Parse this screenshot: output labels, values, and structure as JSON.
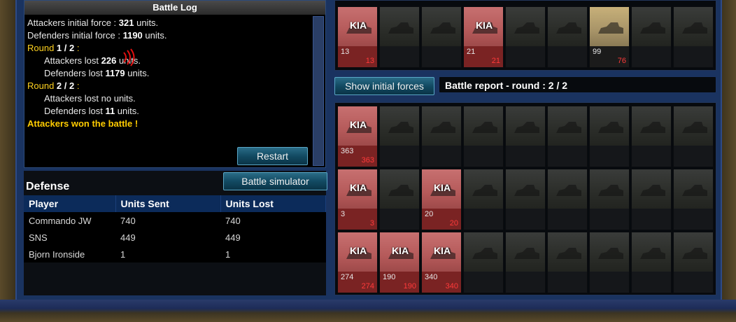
{
  "battle_log": {
    "title": "Battle Log",
    "lines": {
      "l1_pre": "Attackers initial force : ",
      "l1_val": "321",
      "l1_post": " units.",
      "l2_pre": "Defenders initial force : ",
      "l2_val": "1190",
      "l2_post": " units.",
      "r1_pre": "Round ",
      "r1_val": "1 / 2",
      "r1_post": " :",
      "r1a_pre": "Attackers lost ",
      "r1a_val": "226",
      "r1a_post": " units.",
      "r1d_pre": "Defenders lost ",
      "r1d_val": "1179",
      "r1d_post": " units.",
      "r2_pre": "Round ",
      "r2_val": "2 / 2",
      "r2_post": " :",
      "r2a": "Attackers lost no units.",
      "r2d_pre": "Defenders lost ",
      "r2d_val": "11",
      "r2d_post": " units.",
      "result": "Attackers won the battle !"
    },
    "restart_label": "Restart"
  },
  "defense": {
    "title": "Defense",
    "simulator_label": "Battle simulator",
    "columns": [
      "Player",
      "Units Sent",
      "Units Lost"
    ],
    "rows": [
      [
        "Commando JW",
        "740",
        "740"
      ],
      [
        "SNS",
        "449",
        "449"
      ],
      [
        "Bjorn Ironside",
        "1",
        "1"
      ]
    ]
  },
  "report": {
    "show_initial_label": "Show initial forces",
    "title": "Battle report - round : 2 / 2",
    "kia_label": "KIA"
  },
  "top_row": [
    {
      "type": "kia",
      "sent": "13",
      "lost": "13"
    },
    {
      "type": "empty"
    },
    {
      "type": "empty"
    },
    {
      "type": "kia",
      "sent": "21",
      "lost": "21"
    },
    {
      "type": "empty"
    },
    {
      "type": "empty"
    },
    {
      "type": "alive",
      "sent": "99",
      "lost": "76"
    },
    {
      "type": "empty"
    },
    {
      "type": "empty"
    }
  ],
  "grid_rows": [
    [
      {
        "type": "kia",
        "sent": "363",
        "lost": "363"
      },
      {
        "type": "empty"
      },
      {
        "type": "empty"
      },
      {
        "type": "empty"
      },
      {
        "type": "empty"
      },
      {
        "type": "empty"
      },
      {
        "type": "empty"
      },
      {
        "type": "empty"
      },
      {
        "type": "empty"
      }
    ],
    [
      {
        "type": "kia",
        "sent": "3",
        "lost": "3"
      },
      {
        "type": "empty"
      },
      {
        "type": "kia",
        "sent": "20",
        "lost": "20"
      },
      {
        "type": "empty"
      },
      {
        "type": "empty"
      },
      {
        "type": "empty"
      },
      {
        "type": "empty"
      },
      {
        "type": "empty"
      },
      {
        "type": "empty"
      }
    ],
    [
      {
        "type": "kia",
        "sent": "274",
        "lost": "274"
      },
      {
        "type": "kia",
        "sent": "190",
        "lost": "190"
      },
      {
        "type": "kia",
        "sent": "340",
        "lost": "340"
      },
      {
        "type": "empty"
      },
      {
        "type": "empty"
      },
      {
        "type": "empty"
      },
      {
        "type": "empty"
      },
      {
        "type": "empty"
      },
      {
        "type": "empty"
      }
    ]
  ],
  "colors": {
    "accent_yellow": "#ffd21f",
    "kia_red": "#b55a5a",
    "loss_red": "#ff3a3a",
    "button_teal": "#124a62"
  }
}
